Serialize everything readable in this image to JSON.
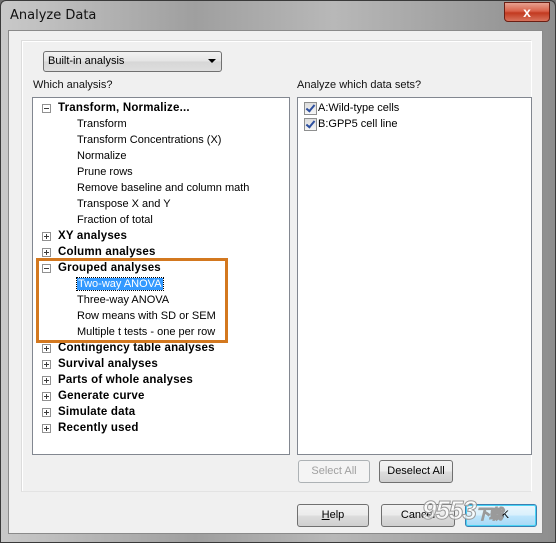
{
  "window": {
    "title": "Analyze Data",
    "close_label": "x"
  },
  "dropdown": {
    "selected": "Built-in analysis"
  },
  "left_panel": {
    "label": "Which analysis?",
    "tree": [
      {
        "label": "Transform, Normalize...",
        "expanded": true,
        "children": [
          "Transform",
          "Transform Concentrations (X)",
          "Normalize",
          "Prune rows",
          "Remove baseline and column math",
          "Transpose X and Y",
          "Fraction of total"
        ]
      },
      {
        "label": "XY analyses",
        "expanded": false,
        "children": []
      },
      {
        "label": "Column analyses",
        "expanded": false,
        "children": []
      },
      {
        "label": "Grouped analyses",
        "expanded": true,
        "children": [
          "Two-way ANOVA",
          "Three-way ANOVA",
          "Row means with SD or SEM",
          "Multiple t tests - one per row"
        ],
        "selected": "Two-way ANOVA"
      },
      {
        "label": "Contingency table analyses",
        "expanded": false,
        "children": []
      },
      {
        "label": "Survival analyses",
        "expanded": false,
        "children": []
      },
      {
        "label": "Parts of whole analyses",
        "expanded": false,
        "children": []
      },
      {
        "label": "Generate curve",
        "expanded": false,
        "children": []
      },
      {
        "label": "Simulate data",
        "expanded": false,
        "children": []
      },
      {
        "label": "Recently used",
        "expanded": false,
        "children": []
      }
    ]
  },
  "right_panel": {
    "label": "Analyze which data sets?",
    "datasets": [
      {
        "label": "A:Wild-type cells",
        "checked": true
      },
      {
        "label": "B:GPP5 cell line",
        "checked": true
      }
    ],
    "select_all": "Select All",
    "deselect_all": "Deselect All"
  },
  "footer": {
    "help": "Help",
    "help_mnemonic": "H",
    "help_rest": "elp",
    "cancel": "Cancel",
    "ok": "OK"
  },
  "watermark": {
    "main": "9553",
    "sub": "下载"
  },
  "colors": {
    "highlight_box": "#d3781f",
    "selection": "#3399ff",
    "close_button": "#c9442a"
  }
}
